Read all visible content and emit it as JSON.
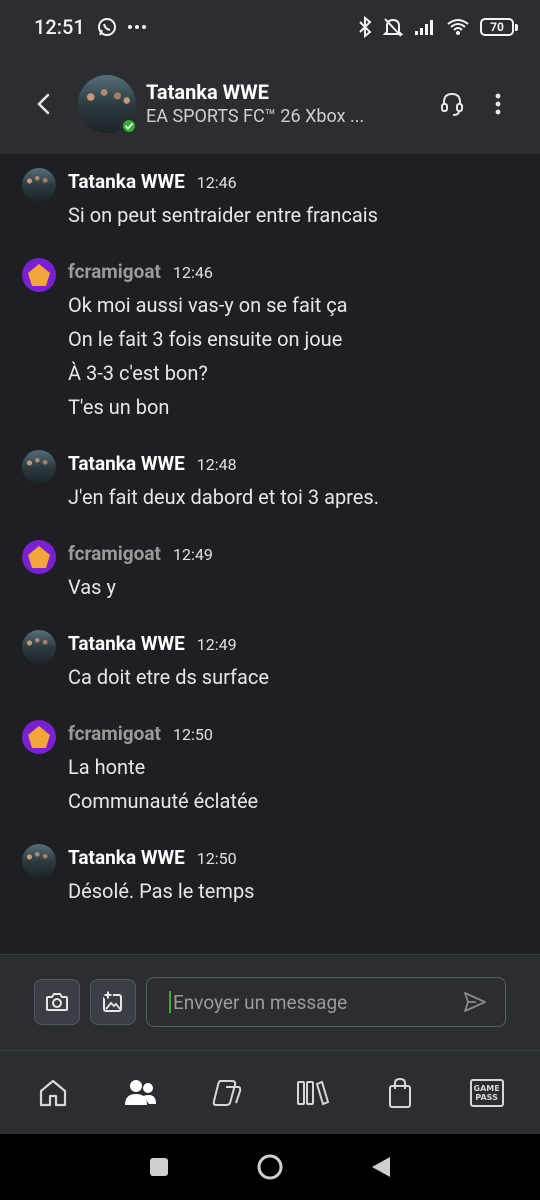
{
  "status": {
    "time": "12:51",
    "battery": "70",
    "icons": [
      "whatsapp-icon",
      "more-dots-icon",
      "bluetooth-icon",
      "mute-icon",
      "signal-icon",
      "wifi-icon",
      "battery-icon"
    ]
  },
  "header": {
    "title": "Tatanka WWE",
    "subtitle": "EA SPORTS FC™ 26 Xbox ...",
    "online_color": "#2eb135"
  },
  "messages": [
    {
      "author": "Tatanka WWE",
      "author_type": "friend",
      "time": "12:46",
      "lines": [
        "Si on peut sentraider entre francais"
      ]
    },
    {
      "author": "fcramigoat",
      "author_type": "self",
      "time": "12:46",
      "lines": [
        "Ok moi aussi vas-y on se fait ça",
        "On le fait 3 fois ensuite on joue",
        "À 3-3 c'est bon?",
        "T'es un bon"
      ]
    },
    {
      "author": "Tatanka WWE",
      "author_type": "friend",
      "time": "12:48",
      "lines": [
        "J'en fait deux dabord et toi 3 apres."
      ]
    },
    {
      "author": "fcramigoat",
      "author_type": "self",
      "time": "12:49",
      "lines": [
        "Vas y"
      ]
    },
    {
      "author": "Tatanka WWE",
      "author_type": "friend",
      "time": "12:49",
      "lines": [
        "Ca doit etre ds surface"
      ]
    },
    {
      "author": "fcramigoat",
      "author_type": "self",
      "time": "12:50",
      "lines": [
        "La honte",
        "Communauté éclatée"
      ]
    },
    {
      "author": "Tatanka WWE",
      "author_type": "friend",
      "time": "12:50",
      "lines": [
        "Désolé. Pas le temps"
      ]
    }
  ],
  "composer": {
    "placeholder": "Envoyer un message",
    "value": ""
  },
  "bottom_nav": {
    "items": [
      "home-icon",
      "friends-icon",
      "copilot-icon",
      "library-icon",
      "store-icon",
      "gamepass-icon"
    ],
    "active": "friends-icon",
    "gamepass_line1": "GAME",
    "gamepass_line2": "PASS"
  },
  "colors": {
    "background": "#1d1f23",
    "bar": "#2b2d31",
    "self_avatar": "#7a1fd1",
    "self_avatar_shape": "#f4a53a",
    "accent_green": "#2eb135"
  }
}
